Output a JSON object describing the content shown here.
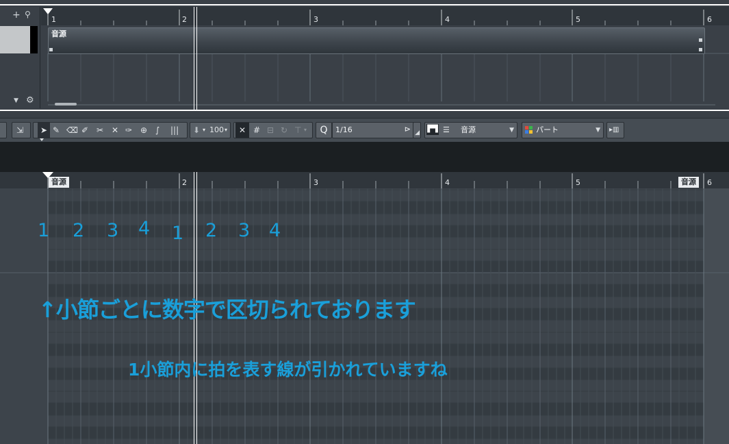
{
  "ruler": {
    "bars": [
      "1",
      "2",
      "3",
      "4",
      "5",
      "6"
    ]
  },
  "arrange": {
    "part_label": "音源"
  },
  "toolbar": {
    "velocity": "100",
    "quantize_label": "Q",
    "quantize_value": "1/16",
    "instrument": "音源",
    "color_mode": "パート"
  },
  "key_editor": {
    "part_start_label": "音源",
    "part_end_label": "音源"
  },
  "annotations": {
    "beats": [
      "1",
      "2",
      "3",
      "4",
      "1",
      "2",
      "3",
      "4"
    ],
    "main": "↑小節ごとに数字で区切られております",
    "sub": "1小節内に拍を表す線が引かれていますね"
  },
  "colors": {
    "accent": "#1a9fd9",
    "cursor": "#ffffff"
  }
}
